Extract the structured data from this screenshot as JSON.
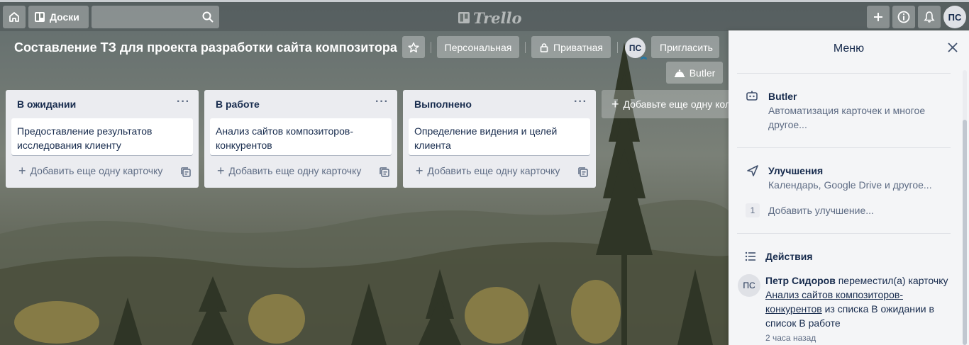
{
  "app": {
    "logo_text": "Trello"
  },
  "header": {
    "boards_label": "Доски",
    "search_placeholder": "",
    "user_initials": "ПС"
  },
  "board": {
    "title": "Составление ТЗ для проекта разработки сайта композитора",
    "team_label": "Персональная",
    "visibility_label": "Приватная",
    "member_initials": "ПС",
    "invite_label": "Пригласить",
    "butler_label": "Butler"
  },
  "lists": [
    {
      "title": "В ожидании",
      "menu": "···",
      "cards": [
        "Предоставление результатов исследования клиенту"
      ],
      "add_card_label": "Добавить еще одну карточку"
    },
    {
      "title": "В работе",
      "menu": "···",
      "cards": [
        "Анализ сайтов композиторов-конкурентов"
      ],
      "add_card_label": "Добавить еще одну карточку"
    },
    {
      "title": "Выполнено",
      "menu": "···",
      "cards": [
        "Определение видения и целей клиента"
      ],
      "add_card_label": "Добавить еще одну карточку"
    }
  ],
  "add_list_label": "Добавьте еще одну колонку",
  "menu": {
    "title": "Меню",
    "butler": {
      "title": "Butler",
      "desc": "Автоматизация карточек и многое другое..."
    },
    "powerups": {
      "title": "Улучшения",
      "desc": "Календарь, Google Drive и другое...",
      "count": "1",
      "add_label": "Добавить улучшение..."
    },
    "activity": {
      "title": "Действия",
      "item": {
        "initials": "ПС",
        "user": "Петр Сидоров",
        "action": " переместил(а) карточку ",
        "card": "Анализ сайтов композиторов-конкурентов",
        "rest": " из списка В ожидании в список В работе",
        "time": "2 часа назад"
      }
    }
  },
  "colors": {
    "list_bg": "#ebecf0",
    "panel_bg": "#f4f5f7",
    "text": "#172b4d",
    "muted": "#5e6c84"
  }
}
